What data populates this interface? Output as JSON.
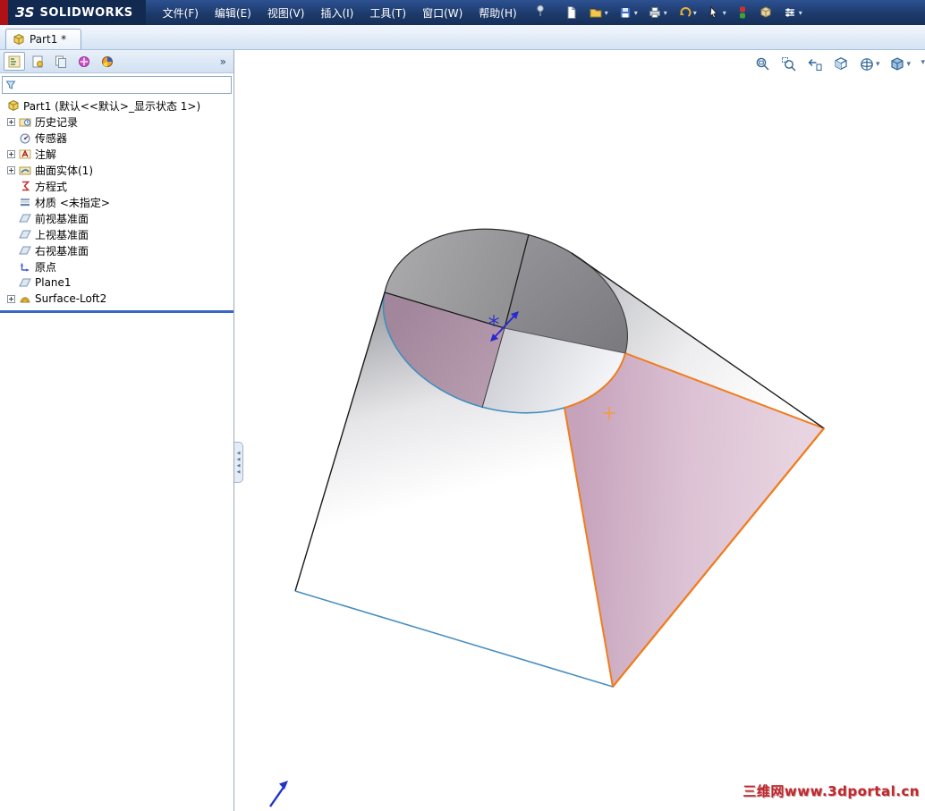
{
  "title_bar": {
    "logo_mark": "ЗS",
    "logo_text": "SOLIDWORKS",
    "menus": [
      {
        "label": "文件(F)"
      },
      {
        "label": "编辑(E)"
      },
      {
        "label": "视图(V)"
      },
      {
        "label": "插入(I)"
      },
      {
        "label": "工具(T)"
      },
      {
        "label": "窗口(W)"
      },
      {
        "label": "帮助(H)"
      }
    ],
    "toolbar_icons": [
      "pin-menu",
      "new-document",
      "open",
      "save",
      "print",
      "undo",
      "select",
      "selection-toggle",
      "appearance",
      "options"
    ]
  },
  "document_tab": {
    "label": "Part1 *"
  },
  "panel": {
    "tabs": [
      "featuremanager",
      "propertymanager",
      "configurationmanager",
      "dimxpert",
      "displaymanager"
    ],
    "overflow_chevrons": "»",
    "tree_root": "Part1 (默认<<默认>_显示状态 1>)",
    "tree_items": [
      {
        "label": "历史记录",
        "expandable": true
      },
      {
        "label": "传感器",
        "expandable": false
      },
      {
        "label": "注解",
        "expandable": true
      },
      {
        "label": "曲面实体(1)",
        "expandable": true
      },
      {
        "label": "方程式",
        "expandable": false
      },
      {
        "label": "材质 <未指定>",
        "expandable": false
      },
      {
        "label": "前视基准面",
        "expandable": false
      },
      {
        "label": "上视基准面",
        "expandable": false
      },
      {
        "label": "右视基准面",
        "expandable": false
      },
      {
        "label": "原点",
        "expandable": false
      },
      {
        "label": "Plane1",
        "expandable": false
      },
      {
        "label": "Surface-Loft2",
        "expandable": true
      }
    ]
  },
  "viewport": {
    "heads_up_icons": [
      "zoom-fit",
      "zoom-area",
      "previous-view",
      "section-view",
      "view-orientation",
      "display-style"
    ],
    "watermark": "三维网www.3dportal.cn"
  },
  "colors": {
    "selection_orange": "#f07c1e",
    "selected_face_pink": "#d9bace",
    "edge_blue": "#4a8fc0",
    "rollback_bar": "#3a66c8",
    "watermark_red": "#c1272d",
    "titlebar_navy": "#1d3a6b"
  }
}
